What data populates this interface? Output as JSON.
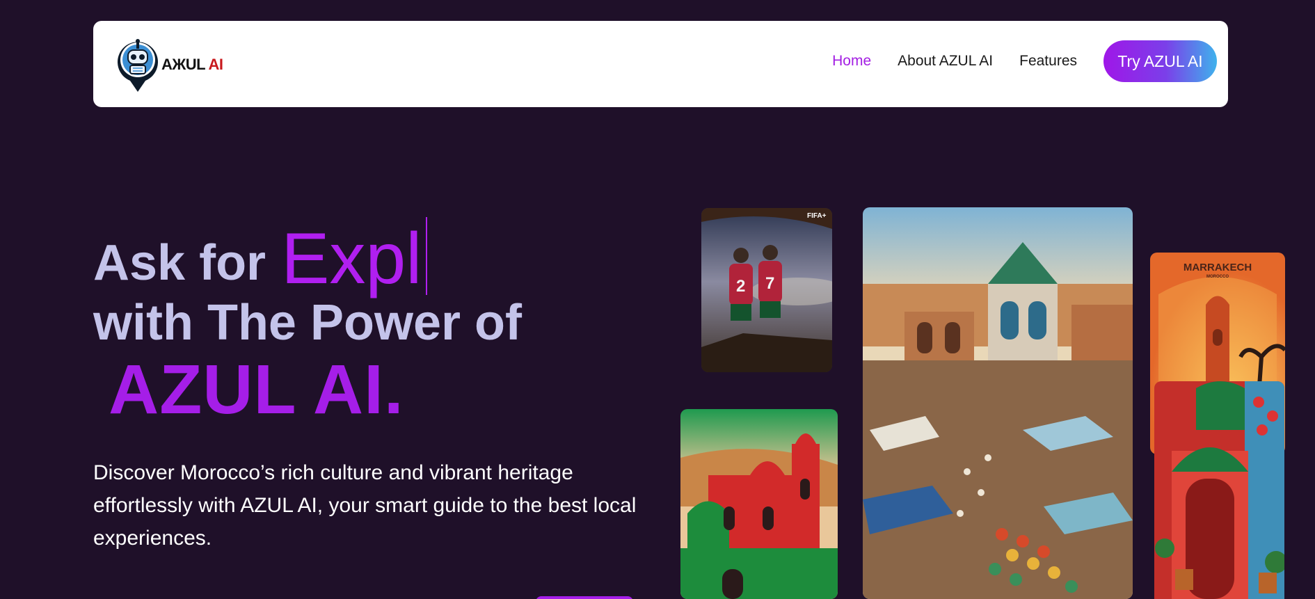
{
  "nav": {
    "logo": {
      "text_main": "AЖUL",
      "text_accent": "AI",
      "icon": "robot-pin-logo"
    },
    "links": [
      {
        "label": "Home",
        "active": true
      },
      {
        "label": "About AZUL AI",
        "active": false
      },
      {
        "label": "Features",
        "active": false
      }
    ],
    "cta_label": "Try AZUL AI"
  },
  "hero": {
    "line1_static": "Ask for",
    "line1_typed": "Expl",
    "line2": "with The Power of",
    "brand": "AZUL AI.",
    "description": "Discover Morocco’s rich culture and vibrant heritage effortlessly with AZUL AI, your smart guide to the best local experiences."
  },
  "gallery": {
    "football_badge": "FIFA+",
    "player_numbers": [
      "2",
      "7"
    ],
    "poster_title": "MARRAKECH",
    "poster_subtitle": "MOROCCO"
  },
  "colors": {
    "background": "#1f1029",
    "accent": "#a51ee8",
    "headline": "#c4c3ea",
    "gradient_end": "#3fb2ec"
  }
}
